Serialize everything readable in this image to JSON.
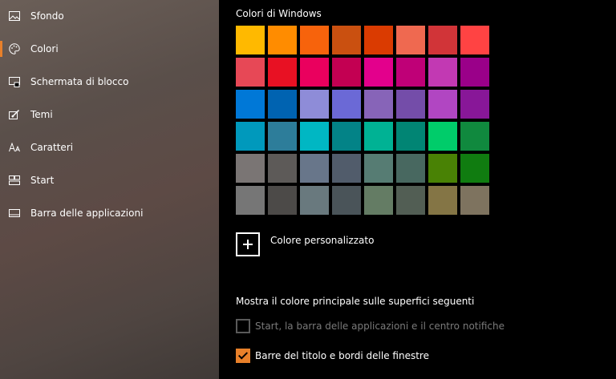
{
  "sidebar": {
    "items": [
      {
        "label": "Sfondo",
        "icon": "picture-icon",
        "active": false
      },
      {
        "label": "Colori",
        "icon": "palette-icon",
        "active": true
      },
      {
        "label": "Schermata di blocco",
        "icon": "lock-screen-icon",
        "active": false
      },
      {
        "label": "Temi",
        "icon": "brush-icon",
        "active": false
      },
      {
        "label": "Caratteri",
        "icon": "font-icon",
        "active": false
      },
      {
        "label": "Start",
        "icon": "start-icon",
        "active": false
      },
      {
        "label": "Barra delle applicazioni",
        "icon": "taskbar-icon",
        "active": false
      }
    ],
    "accent_color": "#e8802a"
  },
  "main": {
    "windows_colors_title": "Colori di Windows",
    "swatches": [
      [
        "#FFB900",
        "#FF8C00",
        "#F7630C",
        "#CA5010",
        "#DA3B01",
        "#EF6950",
        "#D13438",
        "#FF4343"
      ],
      [
        "#E74856",
        "#E81123",
        "#EA005E",
        "#C30052",
        "#E3008C",
        "#BF0077",
        "#C239B3",
        "#9A0089"
      ],
      [
        "#0078D7",
        "#0063B1",
        "#8E8CD8",
        "#6B69D6",
        "#8764B8",
        "#744DA9",
        "#B146C2",
        "#881798"
      ],
      [
        "#0099BC",
        "#2D7D9A",
        "#00B7C3",
        "#038387",
        "#00B294",
        "#018574",
        "#00CC6A",
        "#10893E"
      ],
      [
        "#7A7574",
        "#5D5A58",
        "#68768A",
        "#515C6B",
        "#567C73",
        "#486860",
        "#498205",
        "#107C10"
      ],
      [
        "#767676",
        "#4C4A48",
        "#69797E",
        "#4A5459",
        "#647C64",
        "#525E54",
        "#847545",
        "#7E735F"
      ]
    ],
    "custom_color_label": "Colore personalizzato",
    "surfaces_title": "Mostra il colore principale sulle superfici seguenti",
    "checkbox_start": {
      "label": "Start, la barra delle applicazioni e il centro notifiche",
      "checked": false
    },
    "checkbox_titlebars": {
      "label": "Barre del titolo e bordi delle finestre",
      "checked": true
    }
  }
}
